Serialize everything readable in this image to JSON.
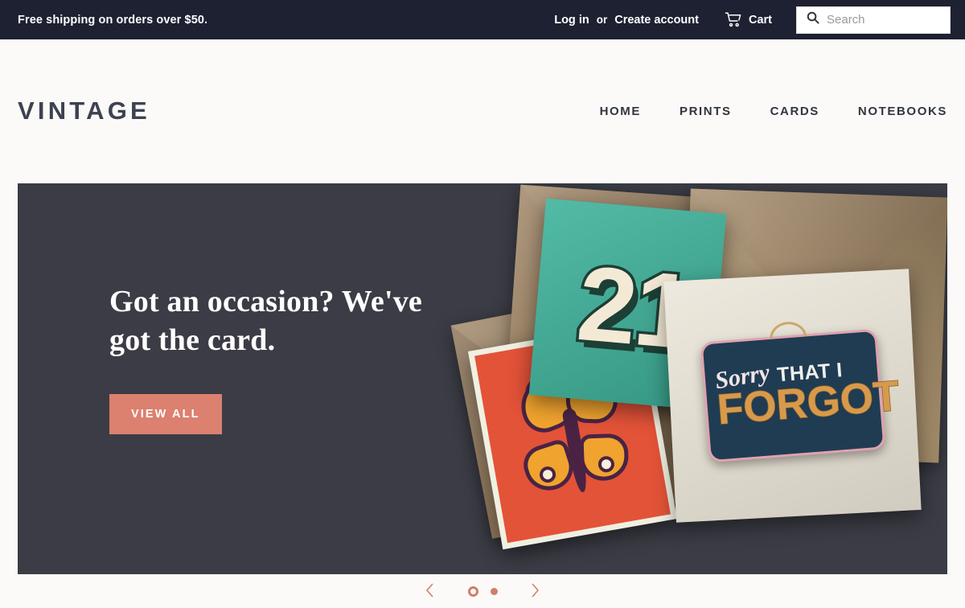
{
  "announcement": {
    "message": "Free shipping on orders over $50.",
    "login_label": "Log in",
    "or_label": "or",
    "create_account_label": "Create account",
    "cart_label": "Cart",
    "cart_icon": "shopping-cart-icon",
    "search_icon": "search-icon",
    "search_placeholder": "Search",
    "search_value": "",
    "background_color": "#1d2132",
    "text_color": "#ffffff"
  },
  "header": {
    "logo": "VINTAGE",
    "logo_color": "#3d4251",
    "nav": [
      {
        "label": "HOME"
      },
      {
        "label": "PRINTS"
      },
      {
        "label": "CARDS"
      },
      {
        "label": "NOTEBOOKS"
      }
    ]
  },
  "hero": {
    "title": "Got an occasion? We've got the card.",
    "button_label": "VIEW ALL",
    "button_color": "#dc8070",
    "background_color": "#3b3c45",
    "artwork": {
      "description": "Assorted greeting cards with kraft paper envelopes on a dark grey surface",
      "cards": [
        {
          "name": "twenty-one-card",
          "text": "21",
          "background": "#3fb39b",
          "ink": "#f3ead6"
        },
        {
          "name": "butterfly-card",
          "text": "",
          "background": "#e35338",
          "ink": "#f0a32e"
        },
        {
          "name": "sorry-that-i-forgot-card",
          "line1_script": "Sorry",
          "line1_rest": "THAT I",
          "line2": "FORGOT",
          "background": "#e9e3d5",
          "sign_color": "#1f3c53",
          "accent": "#d79a4c"
        }
      ],
      "envelope_color": "#9c8468"
    }
  },
  "carousel": {
    "prev_icon": "chevron-left-icon",
    "next_icon": "chevron-right-icon",
    "accent_color": "#cf7f69",
    "slides": [
      {
        "label": "1",
        "active": true
      },
      {
        "label": "2",
        "active": false
      }
    ]
  }
}
